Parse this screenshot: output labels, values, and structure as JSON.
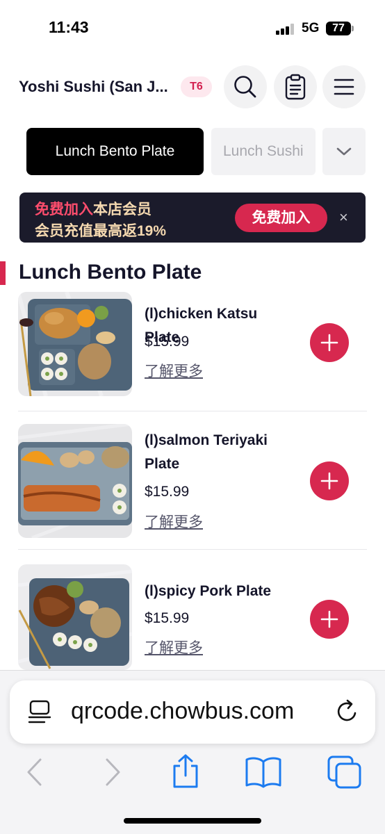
{
  "status_bar": {
    "time": "11:43",
    "network": "5G",
    "battery": "77"
  },
  "header": {
    "store_name": "Yoshi Sushi (San J...",
    "table_badge": "T6",
    "icons": [
      "search-icon",
      "order-list-icon",
      "menu-icon"
    ]
  },
  "category_tabs": [
    {
      "label": "Lunch Bento Plate",
      "active": true
    },
    {
      "label": "Lunch Sushi",
      "active": false
    }
  ],
  "promo_banner": {
    "line1_highlight": "免费加入",
    "line1_rest": "本店会员",
    "line2": "会员充值最高返19%",
    "button_label": "免费加入",
    "close_symbol": "×"
  },
  "section": {
    "title": "Lunch Bento Plate"
  },
  "menu_items": [
    {
      "name": "(l)chicken Katsu Plate",
      "price": "$15.99",
      "more_link": "了解更多"
    },
    {
      "name": "(l)salmon Teriyaki Plate",
      "price": "$15.99",
      "more_link": "了解更多"
    },
    {
      "name": "(l)spicy Pork Plate",
      "price": "$15.99",
      "more_link": "了解更多"
    }
  ],
  "browser": {
    "url": "qrcode.chowbus.com",
    "toolbar": [
      "back-icon",
      "forward-icon",
      "share-icon",
      "bookmarks-icon",
      "tabs-icon"
    ]
  },
  "colors": {
    "accent": "#d7284f",
    "banner_bg": "#1b1b2b",
    "banner_text": "#f5d9b0"
  }
}
